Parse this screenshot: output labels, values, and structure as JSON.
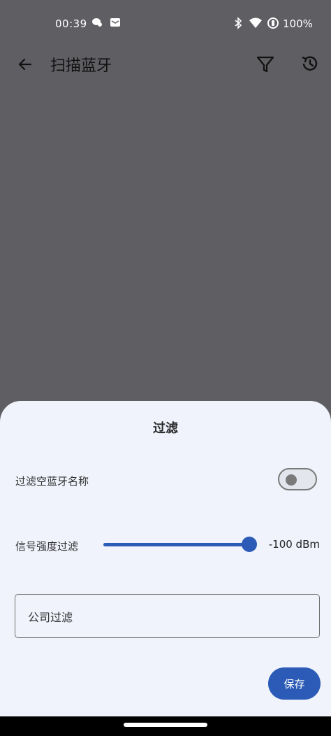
{
  "status_bar": {
    "time": "00:39",
    "battery": "100%",
    "icons": [
      "chat-bubble-icon",
      "mail-icon",
      "bluetooth-icon",
      "wifi-icon",
      "battery-saver-icon"
    ]
  },
  "app_bar": {
    "title": "扫描蓝牙",
    "icons": [
      "back-arrow-icon",
      "filter-icon",
      "history-icon"
    ]
  },
  "filter_sheet": {
    "title": "过滤",
    "filter_empty_name": {
      "label": "过滤空蓝牙名称",
      "enabled": false
    },
    "signal_strength": {
      "label": "信号强度过滤",
      "value_text": "-100 dBm",
      "position_fraction": 0.95
    },
    "company_filter": {
      "placeholder": "公司过滤"
    },
    "save_label": "保存"
  },
  "colors": {
    "scrim": "#5f5f63",
    "sheet_background": "#f0f3fc",
    "primary": "#2b5bb6"
  }
}
